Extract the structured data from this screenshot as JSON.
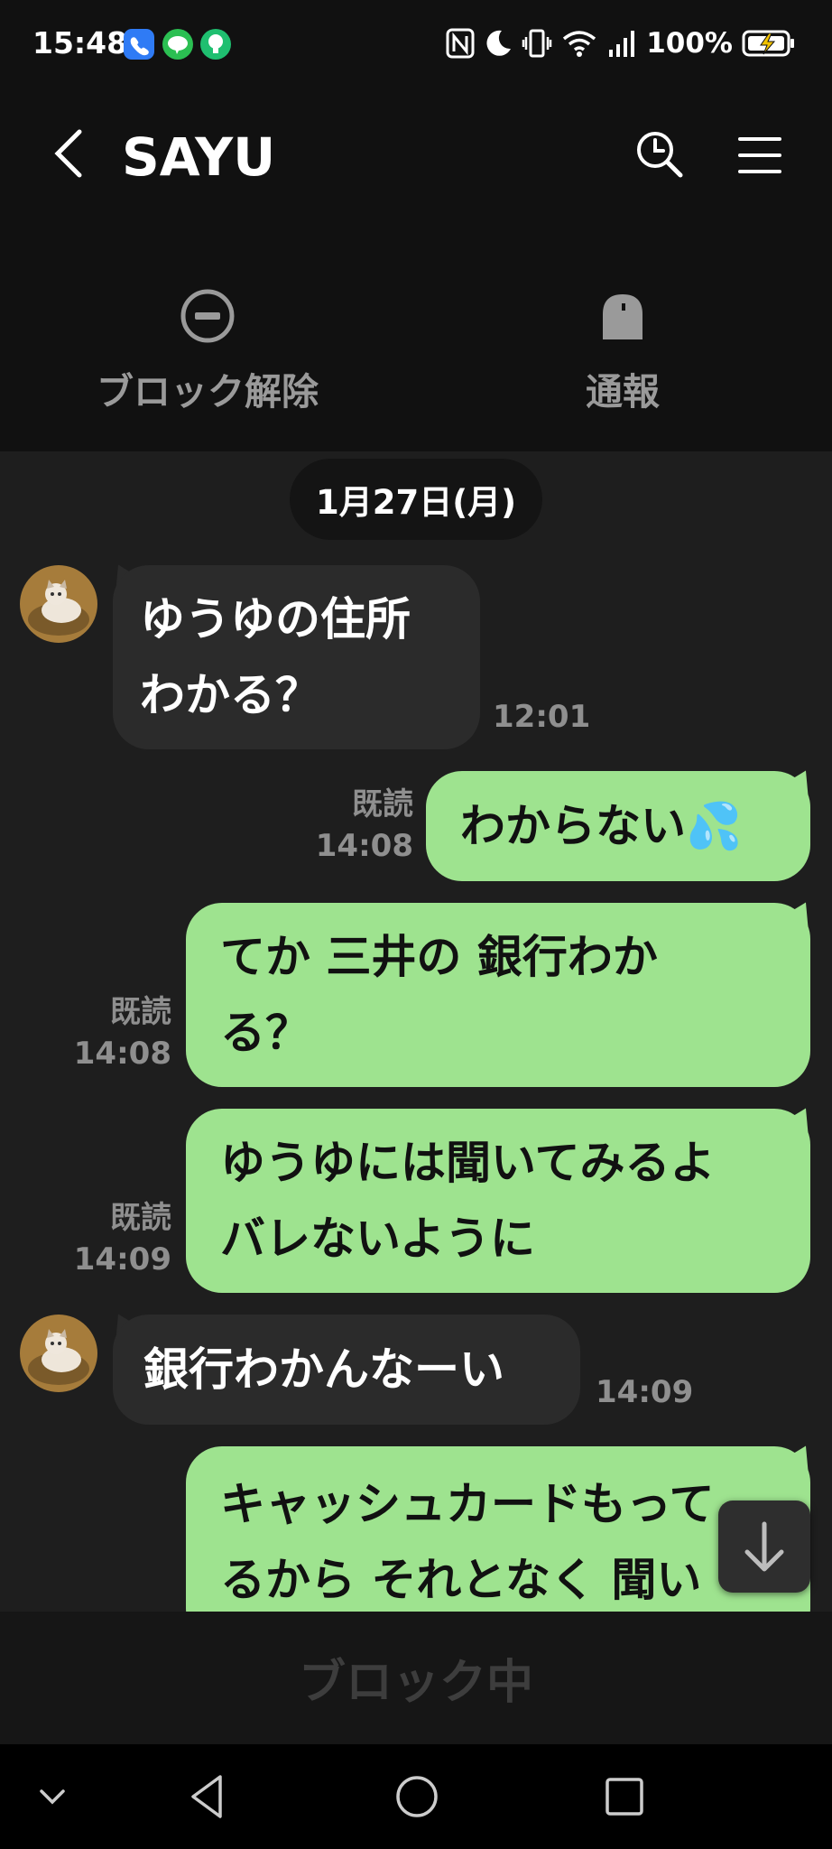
{
  "status_bar": {
    "time": "15:48",
    "battery": "100%"
  },
  "header": {
    "title": "SAYU"
  },
  "actions": {
    "unblock": "ブロック解除",
    "report": "通報"
  },
  "chat": {
    "date": "1月27日(月)",
    "msg1": {
      "lines": [
        "ゆうゆの住所",
        "わかる？"
      ],
      "time": "12:01"
    },
    "msg2": {
      "text": "わからない💦",
      "read": "既読",
      "time": "14:08"
    },
    "msg3": {
      "lines": [
        "てか 三井の 銀行わか",
        "る？"
      ],
      "read": "既読",
      "time": "14:08"
    },
    "msg4": {
      "lines": [
        "ゆうゆには聞いてみるよ",
        "バレないように"
      ],
      "read": "既読",
      "time": "14:09"
    },
    "msg5": {
      "text": "銀行わかんなーい",
      "time": "14:09"
    },
    "msg6": {
      "lines": [
        "キャッシュカードもって",
        "るから  それとなく 聞い"
      ]
    }
  },
  "footer": {
    "blocked_label": "ブロック中"
  },
  "colors": {
    "outgoing_bubble": "#9ee38f",
    "incoming_bubble": "#2b2b2b",
    "background": "#1e1e1e"
  },
  "icons": [
    "back-arrow-icon",
    "search-clock-icon",
    "menu-icon",
    "block-icon",
    "report-bell-icon",
    "scroll-down-icon"
  ]
}
